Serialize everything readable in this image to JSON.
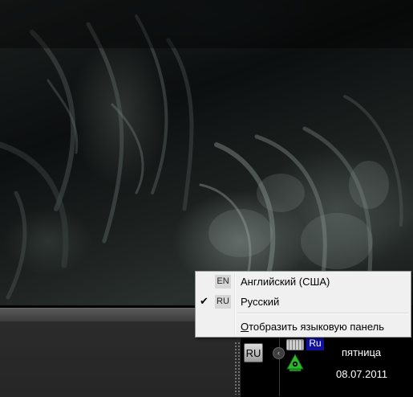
{
  "language_menu": {
    "items": [
      {
        "code": "EN",
        "label": "Английский (США)",
        "checked": false
      },
      {
        "code": "RU",
        "label": "Русский",
        "checked": true
      }
    ],
    "show_panel_accel": "О",
    "show_panel_rest": "тобразить языковую панель",
    "check_mark": "✔"
  },
  "taskbar": {
    "language_button": "RU",
    "tray_language": "Ru",
    "day": "пятница",
    "date": "08.07.2011"
  }
}
